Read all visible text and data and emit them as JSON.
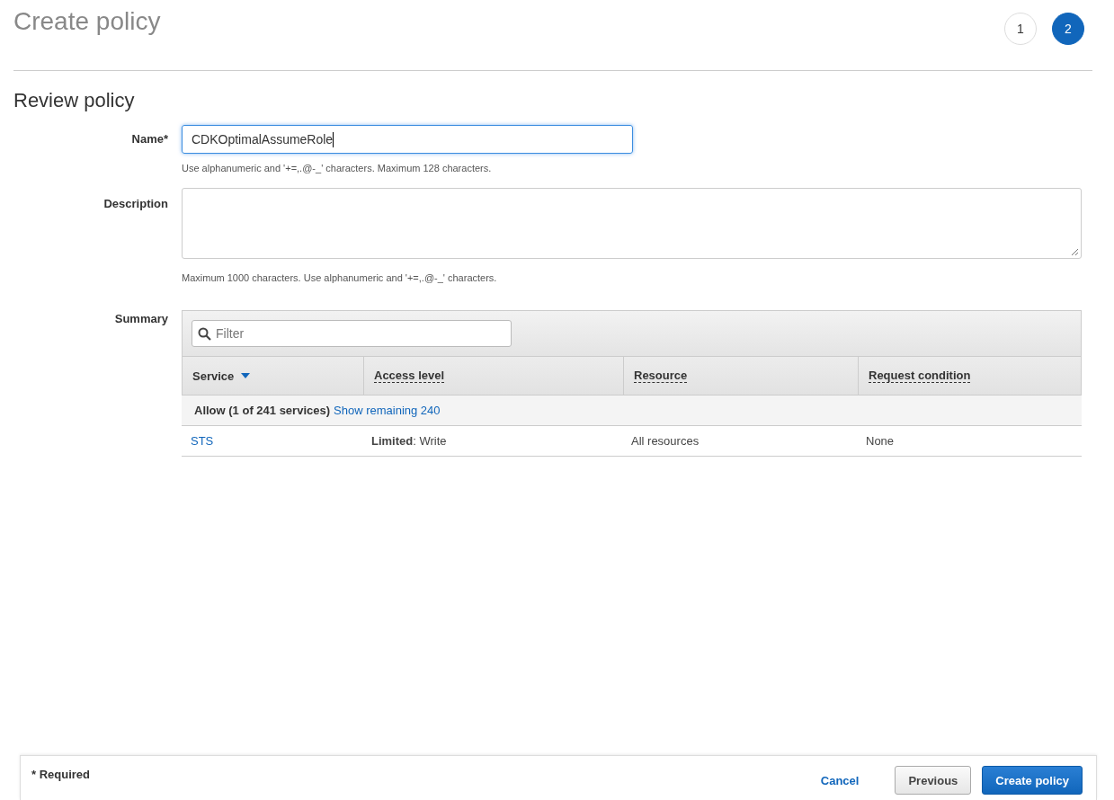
{
  "header": {
    "title": "Create policy",
    "steps": [
      {
        "label": "1",
        "selected": false
      },
      {
        "label": "2",
        "selected": true
      }
    ]
  },
  "section_title": "Review policy",
  "form": {
    "name": {
      "label": "Name*",
      "value": "CDKOptimalAssumeRole",
      "hint": "Use alphanumeric and '+=,.@-_' characters. Maximum 128 characters."
    },
    "description": {
      "label": "Description",
      "hint": "Maximum 1000 characters. Use alphanumeric and '+=,.@-_' characters."
    },
    "summary": {
      "label": "Summary",
      "filter": {
        "placeholder": "Filter"
      },
      "columns": [
        {
          "label": "Service",
          "sorted": true,
          "dashed": false
        },
        {
          "label": "Access level",
          "sorted": false,
          "dashed": true
        },
        {
          "label": "Resource",
          "sorted": false,
          "dashed": true
        },
        {
          "label": "Request condition",
          "sorted": false,
          "dashed": true
        }
      ],
      "group": {
        "label": "Allow (1 of 241 services)",
        "link": "Show remaining 240"
      },
      "rows": [
        {
          "service": "STS",
          "access": "**Limited**: Write",
          "resource": "All resources",
          "condition": "None"
        }
      ]
    }
  },
  "footer": {
    "note": "* Required",
    "buttons": [
      {
        "label": "Cancel",
        "kind": "link"
      },
      {
        "label": "Previous",
        "kind": "secondary"
      },
      {
        "label": "Create policy",
        "kind": "primary"
      }
    ]
  }
}
